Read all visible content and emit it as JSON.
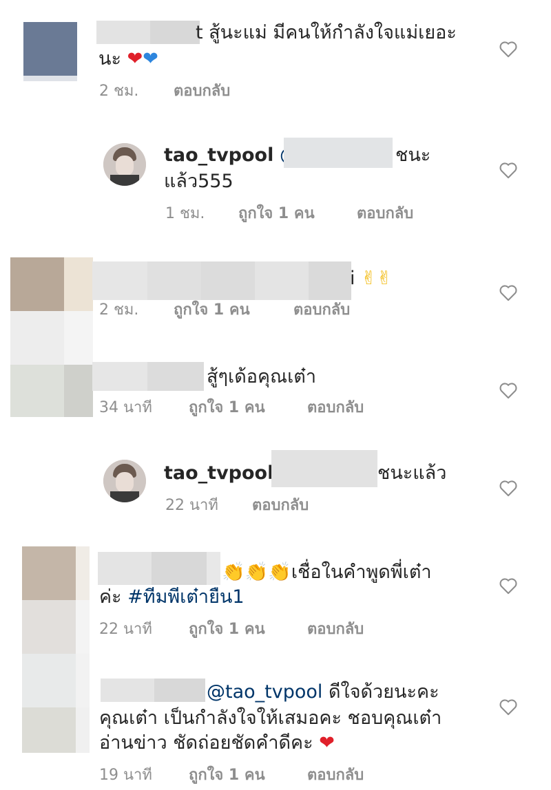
{
  "comments": [
    {
      "id": "c1",
      "text": "t สู้นะแม่ มีคนให้กำลังใจแม่เยอะ",
      "text2": "นะ",
      "emoji": "❤️💙",
      "time": "2 ชม.",
      "reply": "ตอบกลับ"
    },
    {
      "id": "r1",
      "username": "tao_tvpool",
      "mention": "@",
      "text": "ชนะ",
      "text2": "แล้ว555",
      "time": "1 ชม.",
      "likes": "ถูกใจ 1 คน",
      "reply": "ตอบกลับ"
    },
    {
      "id": "c2",
      "text": "i",
      "emoji": "✌️✌️",
      "time": "2 ชม.",
      "likes": "ถูกใจ 1 คน",
      "reply": "ตอบกลับ"
    },
    {
      "id": "c3",
      "text": "สู้ๆเด้อคุณเต๋า",
      "time": "34 นาที",
      "likes": "ถูกใจ 1 คน",
      "reply": "ตอบกลับ"
    },
    {
      "id": "r2",
      "username": "tao_tvpool",
      "mention": "(",
      "text": "ชนะแล้ว",
      "time": "22 นาที",
      "reply": "ตอบกลับ"
    },
    {
      "id": "c4",
      "emoji": "👏👏👏",
      "text": "เชื่อในคำพูดพี่เต๋า",
      "text2a": "ค่ะ ",
      "hashtag": "#ทีมพีเต๋ายืน1",
      "time": "22 นาที",
      "likes": "ถูกใจ 1 คน",
      "reply": "ตอบกลับ"
    },
    {
      "id": "c5",
      "mention": "@tao_tvpool",
      "text": " ดีใจด้วยนะคะ",
      "text2": "คุณเต๋า เป็นกำลังใจให้เสมอคะ ชอบคุณเต๋า",
      "text3": "อ่านข่าว ชัดถ่อยชัดคำดีคะ",
      "emoji": "❤️",
      "time": "19 นาที",
      "likes": "ถูกใจ 1 คน",
      "reply": "ตอบกลับ"
    }
  ],
  "icons": {
    "heart": "heart-outline-icon"
  },
  "colors": {
    "meta": "#8e8e8e",
    "text": "#262626",
    "hashtag": "#003569",
    "red_heart": "#e0202a",
    "blue_heart": "#2e86de"
  }
}
